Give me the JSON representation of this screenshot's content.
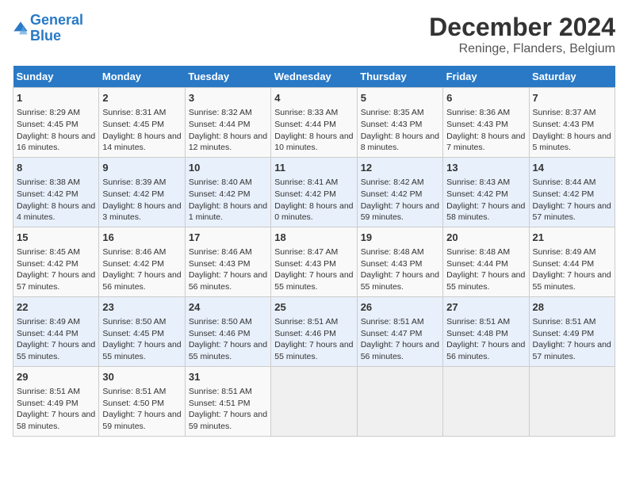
{
  "header": {
    "logo_line1": "General",
    "logo_line2": "Blue",
    "main_title": "December 2024",
    "subtitle": "Reninge, Flanders, Belgium"
  },
  "calendar": {
    "days_of_week": [
      "Sunday",
      "Monday",
      "Tuesday",
      "Wednesday",
      "Thursday",
      "Friday",
      "Saturday"
    ],
    "weeks": [
      [
        {
          "day": "1",
          "sunrise": "Sunrise: 8:29 AM",
          "sunset": "Sunset: 4:45 PM",
          "daylight": "Daylight: 8 hours and 16 minutes."
        },
        {
          "day": "2",
          "sunrise": "Sunrise: 8:31 AM",
          "sunset": "Sunset: 4:45 PM",
          "daylight": "Daylight: 8 hours and 14 minutes."
        },
        {
          "day": "3",
          "sunrise": "Sunrise: 8:32 AM",
          "sunset": "Sunset: 4:44 PM",
          "daylight": "Daylight: 8 hours and 12 minutes."
        },
        {
          "day": "4",
          "sunrise": "Sunrise: 8:33 AM",
          "sunset": "Sunset: 4:44 PM",
          "daylight": "Daylight: 8 hours and 10 minutes."
        },
        {
          "day": "5",
          "sunrise": "Sunrise: 8:35 AM",
          "sunset": "Sunset: 4:43 PM",
          "daylight": "Daylight: 8 hours and 8 minutes."
        },
        {
          "day": "6",
          "sunrise": "Sunrise: 8:36 AM",
          "sunset": "Sunset: 4:43 PM",
          "daylight": "Daylight: 8 hours and 7 minutes."
        },
        {
          "day": "7",
          "sunrise": "Sunrise: 8:37 AM",
          "sunset": "Sunset: 4:43 PM",
          "daylight": "Daylight: 8 hours and 5 minutes."
        }
      ],
      [
        {
          "day": "8",
          "sunrise": "Sunrise: 8:38 AM",
          "sunset": "Sunset: 4:42 PM",
          "daylight": "Daylight: 8 hours and 4 minutes."
        },
        {
          "day": "9",
          "sunrise": "Sunrise: 8:39 AM",
          "sunset": "Sunset: 4:42 PM",
          "daylight": "Daylight: 8 hours and 3 minutes."
        },
        {
          "day": "10",
          "sunrise": "Sunrise: 8:40 AM",
          "sunset": "Sunset: 4:42 PM",
          "daylight": "Daylight: 8 hours and 1 minute."
        },
        {
          "day": "11",
          "sunrise": "Sunrise: 8:41 AM",
          "sunset": "Sunset: 4:42 PM",
          "daylight": "Daylight: 8 hours and 0 minutes."
        },
        {
          "day": "12",
          "sunrise": "Sunrise: 8:42 AM",
          "sunset": "Sunset: 4:42 PM",
          "daylight": "Daylight: 7 hours and 59 minutes."
        },
        {
          "day": "13",
          "sunrise": "Sunrise: 8:43 AM",
          "sunset": "Sunset: 4:42 PM",
          "daylight": "Daylight: 7 hours and 58 minutes."
        },
        {
          "day": "14",
          "sunrise": "Sunrise: 8:44 AM",
          "sunset": "Sunset: 4:42 PM",
          "daylight": "Daylight: 7 hours and 57 minutes."
        }
      ],
      [
        {
          "day": "15",
          "sunrise": "Sunrise: 8:45 AM",
          "sunset": "Sunset: 4:42 PM",
          "daylight": "Daylight: 7 hours and 57 minutes."
        },
        {
          "day": "16",
          "sunrise": "Sunrise: 8:46 AM",
          "sunset": "Sunset: 4:42 PM",
          "daylight": "Daylight: 7 hours and 56 minutes."
        },
        {
          "day": "17",
          "sunrise": "Sunrise: 8:46 AM",
          "sunset": "Sunset: 4:43 PM",
          "daylight": "Daylight: 7 hours and 56 minutes."
        },
        {
          "day": "18",
          "sunrise": "Sunrise: 8:47 AM",
          "sunset": "Sunset: 4:43 PM",
          "daylight": "Daylight: 7 hours and 55 minutes."
        },
        {
          "day": "19",
          "sunrise": "Sunrise: 8:48 AM",
          "sunset": "Sunset: 4:43 PM",
          "daylight": "Daylight: 7 hours and 55 minutes."
        },
        {
          "day": "20",
          "sunrise": "Sunrise: 8:48 AM",
          "sunset": "Sunset: 4:44 PM",
          "daylight": "Daylight: 7 hours and 55 minutes."
        },
        {
          "day": "21",
          "sunrise": "Sunrise: 8:49 AM",
          "sunset": "Sunset: 4:44 PM",
          "daylight": "Daylight: 7 hours and 55 minutes."
        }
      ],
      [
        {
          "day": "22",
          "sunrise": "Sunrise: 8:49 AM",
          "sunset": "Sunset: 4:44 PM",
          "daylight": "Daylight: 7 hours and 55 minutes."
        },
        {
          "day": "23",
          "sunrise": "Sunrise: 8:50 AM",
          "sunset": "Sunset: 4:45 PM",
          "daylight": "Daylight: 7 hours and 55 minutes."
        },
        {
          "day": "24",
          "sunrise": "Sunrise: 8:50 AM",
          "sunset": "Sunset: 4:46 PM",
          "daylight": "Daylight: 7 hours and 55 minutes."
        },
        {
          "day": "25",
          "sunrise": "Sunrise: 8:51 AM",
          "sunset": "Sunset: 4:46 PM",
          "daylight": "Daylight: 7 hours and 55 minutes."
        },
        {
          "day": "26",
          "sunrise": "Sunrise: 8:51 AM",
          "sunset": "Sunset: 4:47 PM",
          "daylight": "Daylight: 7 hours and 56 minutes."
        },
        {
          "day": "27",
          "sunrise": "Sunrise: 8:51 AM",
          "sunset": "Sunset: 4:48 PM",
          "daylight": "Daylight: 7 hours and 56 minutes."
        },
        {
          "day": "28",
          "sunrise": "Sunrise: 8:51 AM",
          "sunset": "Sunset: 4:49 PM",
          "daylight": "Daylight: 7 hours and 57 minutes."
        }
      ],
      [
        {
          "day": "29",
          "sunrise": "Sunrise: 8:51 AM",
          "sunset": "Sunset: 4:49 PM",
          "daylight": "Daylight: 7 hours and 58 minutes."
        },
        {
          "day": "30",
          "sunrise": "Sunrise: 8:51 AM",
          "sunset": "Sunset: 4:50 PM",
          "daylight": "Daylight: 7 hours and 59 minutes."
        },
        {
          "day": "31",
          "sunrise": "Sunrise: 8:51 AM",
          "sunset": "Sunset: 4:51 PM",
          "daylight": "Daylight: 7 hours and 59 minutes."
        },
        null,
        null,
        null,
        null
      ]
    ]
  }
}
